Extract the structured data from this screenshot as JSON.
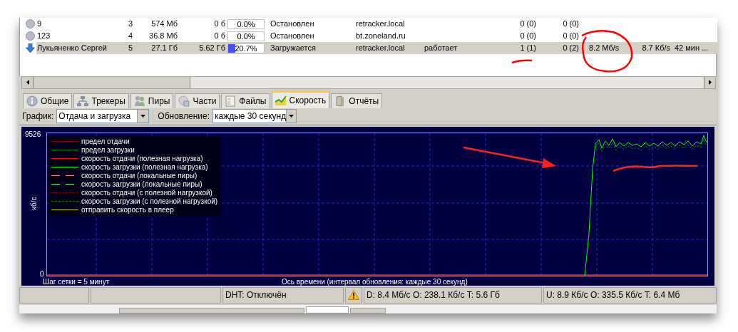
{
  "table": {
    "rows": [
      {
        "kind": "stopped",
        "selected": false,
        "level": 0,
        "column_1": "9",
        "column_2": "3",
        "column_3": "574 Мб",
        "column_4": "0 б",
        "column_5": "0.0%",
        "column_6": "Остановлен",
        "column_7": "retracker.local",
        "column_9": "0 (0)",
        "column_10": "0 (0)"
      },
      {
        "kind": "stopped",
        "selected": false,
        "level": 0,
        "column_1": "123",
        "column_2": "4",
        "column_3": "36.8 Мб",
        "column_4": "0 б",
        "column_5": "0.0%",
        "column_6": "Остановлен",
        "column_7": "bt.zoneland.ru",
        "column_9": "0 (0)",
        "column_10": "0 (0)"
      },
      {
        "kind": "downloading",
        "selected": true,
        "level": 0.207,
        "column_1": "Лукьяненко Сергей",
        "column_2": "5",
        "column_3": "27.1 Гб",
        "column_4": "5.62 Гб",
        "column_5": "20.7%",
        "column_6": "Загружается",
        "column_7": "retracker.local",
        "column_8": "работает",
        "column_9": "1 (1)",
        "column_10": "0 (2)",
        "column_11": "8.2 Мб/s",
        "column_12": "8.7 Кб/s",
        "column_13": "42 мин ..."
      }
    ]
  },
  "tabs": [
    {
      "label": "Общие",
      "selected": false
    },
    {
      "label": "Трекеры",
      "selected": false
    },
    {
      "label": "Пиры",
      "selected": false
    },
    {
      "label": "Части",
      "selected": false
    },
    {
      "label": "Файлы",
      "selected": false
    },
    {
      "label": "Скорость",
      "selected": true
    },
    {
      "label": "Отчёты",
      "selected": false
    }
  ],
  "toolbar": {
    "graph_label": "График:",
    "graph_value": "Отдача и загрузка",
    "update_label": "Обновление:",
    "update_value": "каждые 30 секунд"
  },
  "chart": {
    "y_max": "9526",
    "y_min": "0",
    "y_unit": "кб/с",
    "grid_note": "Шаг сетки = 5 минут",
    "time_axis_note": "Ось времени (интервал обновления: каждые 30 секунд)",
    "legend": [
      {
        "label": "предел отдачи",
        "color": "#800000",
        "kind": "solid"
      },
      {
        "label": "предел загрузки",
        "color": "#008000",
        "kind": "solid"
      },
      {
        "label": "скорость отдачи (полезная нагрузка)",
        "color": "#ff0000",
        "kind": "solid"
      },
      {
        "label": "скорость загрузки (полезная нагрузка)",
        "color": "#00ff00",
        "kind": "solid"
      },
      {
        "label": "скорость отдачи (локальные пиры)",
        "color": "#ff8080",
        "kind": "long-dash"
      },
      {
        "label": "скорость загрузки (локальные пиры)",
        "color": "#80ff80",
        "kind": "long-dash"
      },
      {
        "label": "скорость отдачи (с полезной нагрузкой)",
        "color": "#800000",
        "kind": "short-dash"
      },
      {
        "label": "скорость загрузки (с полезной нагрузкой)",
        "color": "#008000",
        "kind": "short-dash"
      },
      {
        "label": "отправить скорость в плеер",
        "color": "#c0c000",
        "kind": "solid"
      }
    ]
  },
  "status_bar": {
    "dht": "DHT: Отключён",
    "download": "D: 8.4 Мб/с O: 238.1 Кб/с T: 5.6 Гб",
    "upload": "U: 8.9 Кб/с O: 335.5 Кб/с T: 6.4 Мб"
  }
}
